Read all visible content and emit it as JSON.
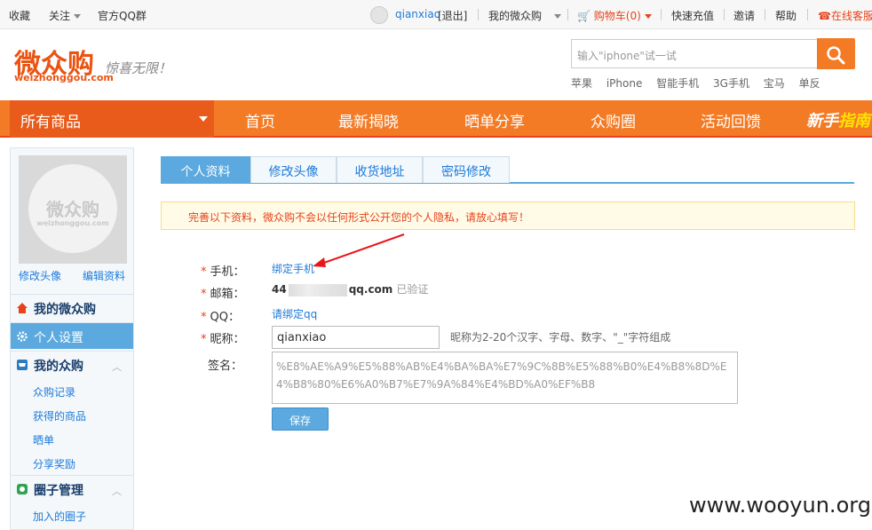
{
  "topbar": {
    "favorite": "收藏",
    "follow": "关注",
    "qq_group": "官方QQ群",
    "username": "qianxiao",
    "logout": "[退出]",
    "my_account": "我的微众购",
    "cart": "购物车(0)",
    "recharge": "快速充值",
    "invite": "邀请",
    "help": "帮助",
    "service": "在线客服"
  },
  "header": {
    "logo_cn": "微众购",
    "logo_en": "weizhonggou.com",
    "slogan": "惊喜无限！",
    "search_placeholder": "输入\"iphone\"试一试",
    "hotwords": [
      "苹果",
      "iPhone",
      "智能手机",
      "3G手机",
      "宝马",
      "单反"
    ]
  },
  "nav": {
    "all_products": "所有商品",
    "links": [
      "首页",
      "最新揭晓",
      "晒单分享",
      "众购圈",
      "活动回馈"
    ],
    "newbie_a": "新手",
    "newbie_b": "指南"
  },
  "sidebar": {
    "avatar_cn": "微众购",
    "avatar_en": "weizhonggou.com",
    "edit_avatar": "修改头像",
    "edit_profile": "编辑资料",
    "sections": {
      "my_home": "我的微众购",
      "settings": "个人设置",
      "my_buy": "我的众购",
      "circle": "圈子管理"
    },
    "buy_items": [
      "众购记录",
      "获得的商品",
      "晒单",
      "分享奖励"
    ],
    "circle_items": [
      "加入的圈子"
    ]
  },
  "tabs": [
    "个人资料",
    "修改头像",
    "收货地址",
    "密码修改"
  ],
  "notice": "完善以下资料，微众购不会以任何形式公开您的个人隐私，请放心填写！",
  "form": {
    "phone_label": "手机：",
    "phone_link": "绑定手机",
    "email_label": "邮箱：",
    "email_prefix": "44",
    "email_suffix": "qq.com",
    "email_verified": "已验证",
    "qq_label": "QQ：",
    "qq_link": "请绑定qq",
    "nick_label": "昵称：",
    "nick_value": "qianxiao",
    "nick_hint": "昵称为2-20个汉字、字母、数字、\"_\"字符组成",
    "sig_label": "签名：",
    "sig_value": "%E8%AE%A9%E5%88%AB%E4%BA%BA%E7%9C%8B%E5%88%B0%E4%B8%8D%E4%B8%80%E6%A0%B7%E7%9A%84%E4%BD%A0%EF%B8",
    "save": "保存"
  },
  "watermark": "www.wooyun.org",
  "colors": {
    "accent_orange": "#f47b25",
    "accent_blue": "#5ba9de",
    "warning_red": "#e8421b"
  }
}
